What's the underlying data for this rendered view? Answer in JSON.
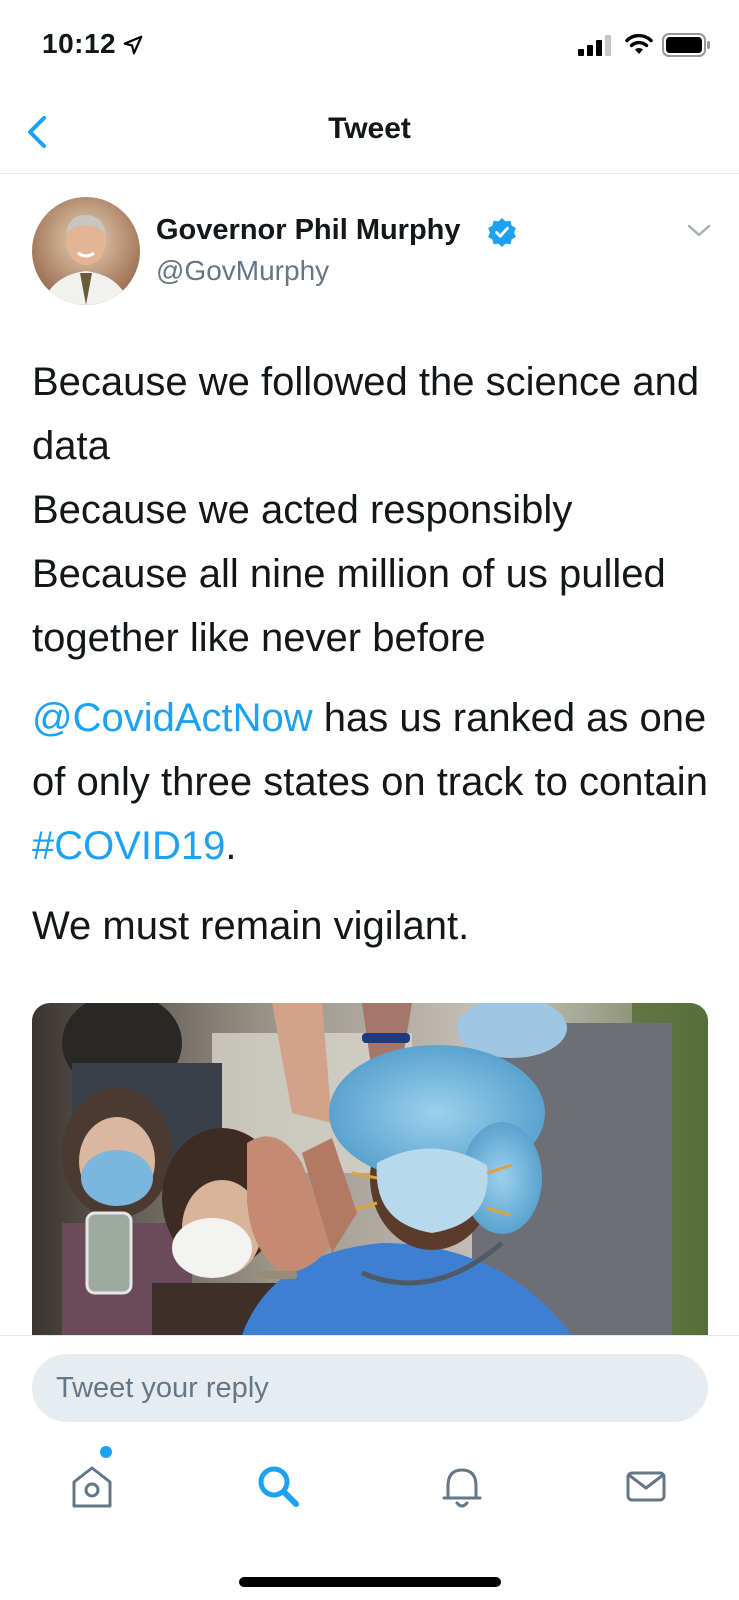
{
  "status_bar": {
    "time": "10:12",
    "icons": [
      "location-arrow-icon",
      "signal-icon",
      "wifi-icon",
      "battery-icon"
    ]
  },
  "nav": {
    "title": "Tweet",
    "back_icon": "chevron-left-icon"
  },
  "tweet": {
    "author": {
      "name": "Governor Phil Murphy",
      "handle": "@GovMurphy",
      "verified": true
    },
    "body": {
      "lines": [
        "Because we followed the science and data",
        "Because we acted responsibly",
        "Because all nine million of us pulled together like never before"
      ],
      "mention": "@CovidActNow",
      "mid_text": " has us ranked as one of only three states on track to contain ",
      "hashtag": "#COVID19",
      "after_hashtag": ".",
      "closing": "We must remain vigilant."
    },
    "media_description_icon": "photo-icon"
  },
  "reply": {
    "placeholder": "Tweet your reply"
  },
  "tab_bar": {
    "items": [
      "home-icon",
      "search-icon",
      "notifications-icon",
      "messages-icon"
    ]
  },
  "colors": {
    "accent": "#1da1f2",
    "text": "#14171a",
    "secondary": "#657786",
    "input_bg": "#e6ecf0"
  }
}
